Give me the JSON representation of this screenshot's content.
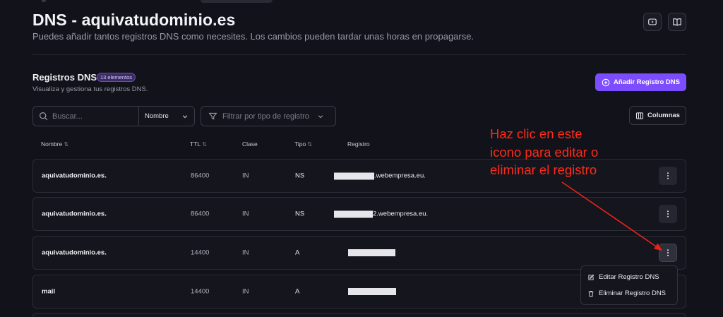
{
  "header": {
    "title": "DNS - aquivatudominio.es",
    "subtitle": "Puedes añadir tantos registros DNS como necesites. Los cambios pueden tardar unas horas en propagarse.",
    "video_icon": "video-icon",
    "book_icon": "book-icon"
  },
  "section": {
    "title": "Registros DNS",
    "badge": "13 elementos",
    "subtitle": "Visualiza y gestiona tus registros DNS.",
    "add_button": "Añadir Registro DNS"
  },
  "filters": {
    "search_placeholder": "Buscar...",
    "search_by": "Nombre",
    "type_filter_placeholder": "Filtrar por tipo de registro",
    "columns_button": "Columnas"
  },
  "table": {
    "columns": [
      "Nombre",
      "TTL",
      "Clase",
      "Tipo",
      "Registro"
    ],
    "sort_icon": "⇅",
    "rows": [
      {
        "name": "aquivatudominio.es.",
        "ttl": "86400",
        "class": "IN",
        "type": "NS",
        "record_suffix": ".webempresa.eu."
      },
      {
        "name": "aquivatudominio.es.",
        "ttl": "86400",
        "class": "IN",
        "type": "NS",
        "record_suffix": "2.webempresa.eu."
      },
      {
        "name": "aquivatudominio.es.",
        "ttl": "14400",
        "class": "IN",
        "type": "A",
        "record_suffix": ""
      },
      {
        "name": "mail",
        "ttl": "14400",
        "class": "IN",
        "type": "A",
        "record_suffix": ""
      }
    ]
  },
  "context_menu": {
    "edit": "Editar Registro DNS",
    "delete": "Eliminar Registro DNS"
  },
  "annotation": {
    "line1": "Haz clic en este",
    "line2": "icono para editar o",
    "line3": "eliminar el registro",
    "color": "#ff2a1a"
  },
  "colors": {
    "background": "#12121a",
    "accent": "#7c4dff"
  }
}
